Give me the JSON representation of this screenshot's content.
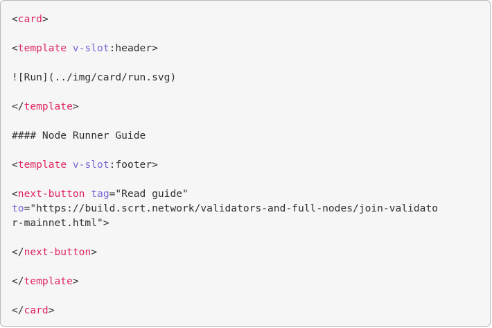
{
  "colors": {
    "background": "#f6f6f6",
    "border": "#b8b8b8",
    "text": "#2f2f2f",
    "tag": "#e0245e",
    "attribute": "#7a64d6"
  },
  "code": {
    "card_open": {
      "lt": "<",
      "tag": "card",
      "gt": ">"
    },
    "template_header": {
      "lt": "<",
      "tag": "template",
      "sp": " ",
      "attr": "v-slot",
      "rest": ":header>"
    },
    "image_markdown": "![Run](../img/card/run.svg)",
    "template_close_1": {
      "lt": "</",
      "tag": "template",
      "gt": ">"
    },
    "heading": "#### Node Runner Guide",
    "template_footer": {
      "lt": "<",
      "tag": "template",
      "sp": " ",
      "attr": "v-slot",
      "rest": ":footer>"
    },
    "next_button_open": {
      "lt": "<",
      "tag": "next-button",
      "sp": " ",
      "attr1": "tag",
      "val1": "=\"Read guide\"",
      "attr2": "to",
      "val2": "=\"https://build.scrt.network/validators-and-full-nodes/join-validato",
      "val2_cont": "r-mainnet.html\">"
    },
    "next_button_close": {
      "lt": "</",
      "tag": "next-button",
      "gt": ">"
    },
    "template_close_2": {
      "lt": "</",
      "tag": "template",
      "gt": ">"
    },
    "card_close": {
      "lt": "</",
      "tag": "card",
      "gt": ">"
    }
  }
}
